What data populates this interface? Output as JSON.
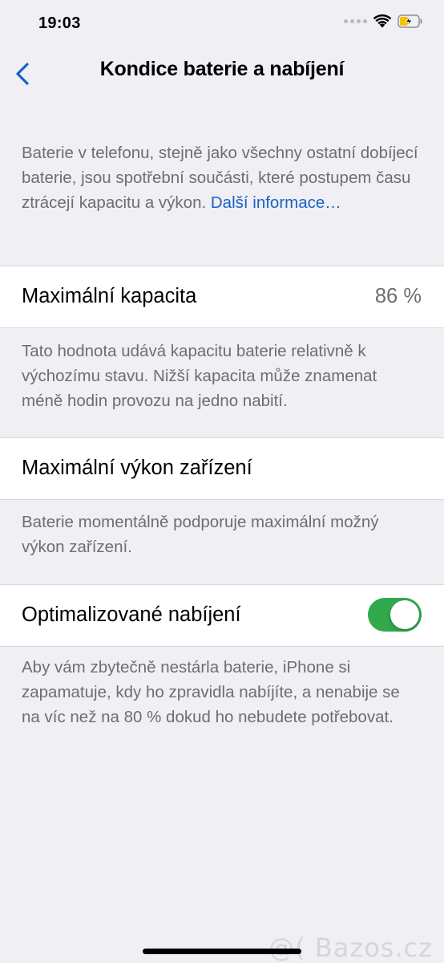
{
  "status_bar": {
    "time": "19:03",
    "icons": [
      "cellular-signal-icon",
      "wifi-icon",
      "battery-charging-icon"
    ]
  },
  "nav": {
    "back_icon": "chevron-left-icon",
    "title": "Kondice baterie a nabíjení"
  },
  "intro": {
    "text": "Baterie v telefonu, stejně jako všechny ostatní dobíjecí baterie, jsou spotřební součásti, které postupem času ztrácejí kapacitu a výkon.",
    "link": "Další informace…"
  },
  "capacity": {
    "label": "Maximální kapacita",
    "value": "86 %",
    "footer": "Tato hodnota udává kapacitu baterie relativně k výchozímu stavu. Nižší kapacita může znamenat méně hodin provozu na jedno nabití."
  },
  "performance": {
    "label": "Maximální výkon zařízení",
    "footer": "Baterie momentálně podporuje maximální možný výkon zařízení."
  },
  "optimized": {
    "label": "Optimalizované nabíjení",
    "enabled": true,
    "footer": "Aby vám zbytečně nestárla baterie, iPhone si zapamatuje, kdy ho zpravidla nabíjíte, a nenabije se na víc než na 80 % dokud ho nebudete potřebovat."
  },
  "watermark": "@( Bazos.cz",
  "colors": {
    "accent": "#1863c3",
    "toggle_on": "#32a94c",
    "background": "#efeff4",
    "secondary_text": "#6d6d72"
  }
}
